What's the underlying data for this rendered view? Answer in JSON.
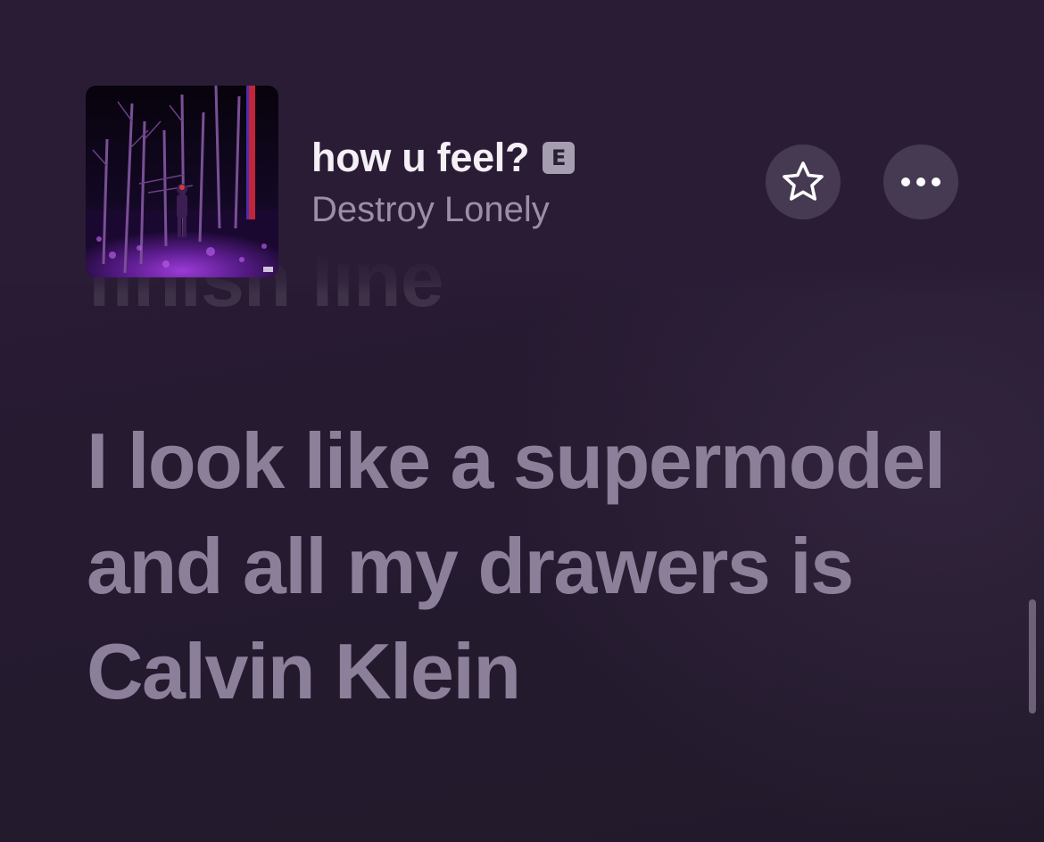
{
  "header": {
    "track_title": "how u feel?",
    "explicit_badge": "E",
    "artist": "Destroy Lonely"
  },
  "icons": {
    "favorite": "star-outline-icon",
    "more": "ellipsis-icon"
  },
  "lyrics": {
    "previous_line_fragment": "finish line",
    "current_line": "I look like a supermodel and all my drawers is Calvin Klein"
  },
  "colors": {
    "background": "#2b1c36",
    "lyric_active": "#8c7f99",
    "button_fill": "#463a52",
    "artist_text": "#9a8fa6"
  }
}
